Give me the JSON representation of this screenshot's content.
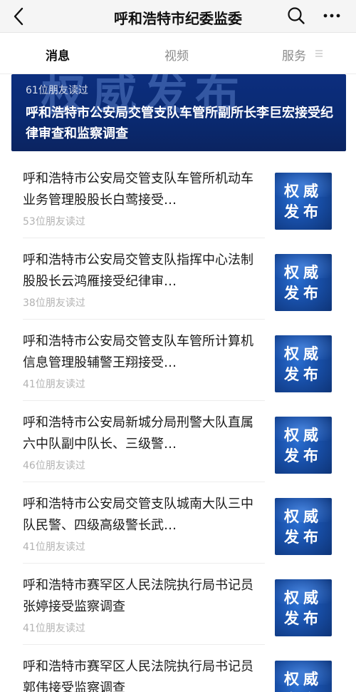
{
  "header": {
    "title": "呼和浩特市纪委监委",
    "back_icon": "chevron-left-icon",
    "search_icon": "search-icon",
    "more_icon": "more-dots-icon"
  },
  "tabs": [
    {
      "label": "消息",
      "active": true
    },
    {
      "label": "视频",
      "active": false
    },
    {
      "label": "服务",
      "active": false
    }
  ],
  "banner": {
    "image_text": "权威发布",
    "reads": "61位朋友读过",
    "title": "呼和浩特市公安局交管支队车管所副所长李巨宏接受纪律审查和监察调查"
  },
  "articles": [
    {
      "title": "呼和浩特市公安局交管支队车管所机动车业务管理股股长白莺接受…",
      "reads": "53位朋友读过",
      "thumb_text": "权威发布"
    },
    {
      "title": "呼和浩特市公安局交管支队指挥中心法制股股长云鸿雁接受纪律审…",
      "reads": "38位朋友读过",
      "thumb_text": "权威发布"
    },
    {
      "title": "呼和浩特市公安局交管支队车管所计算机信息管理股辅警王翔接受…",
      "reads": "41位朋友读过",
      "thumb_text": "权威发布"
    },
    {
      "title": "呼和浩特市公安局新城分局刑警大队直属六中队副中队长、三级警…",
      "reads": "46位朋友读过",
      "thumb_text": "权威发布"
    },
    {
      "title": "呼和浩特市公安局交管支队城南大队三中队民警、四级高级警长武…",
      "reads": "41位朋友读过",
      "thumb_text": "权威发布"
    },
    {
      "title": "呼和浩特市赛罕区人民法院执行局书记员张婷接受监察调查",
      "reads": "41位朋友读过",
      "thumb_text": "权威发布"
    },
    {
      "title": "呼和浩特市赛罕区人民法院执行局书记员郭伟接受监察调查",
      "reads": "",
      "thumb_text": "权威发布"
    }
  ],
  "colors": {
    "banner_bg": "#0c2e7e",
    "thumb_bg": "#184fa8",
    "text_primary": "#1a1a1a",
    "text_secondary": "#b2b2b2"
  }
}
